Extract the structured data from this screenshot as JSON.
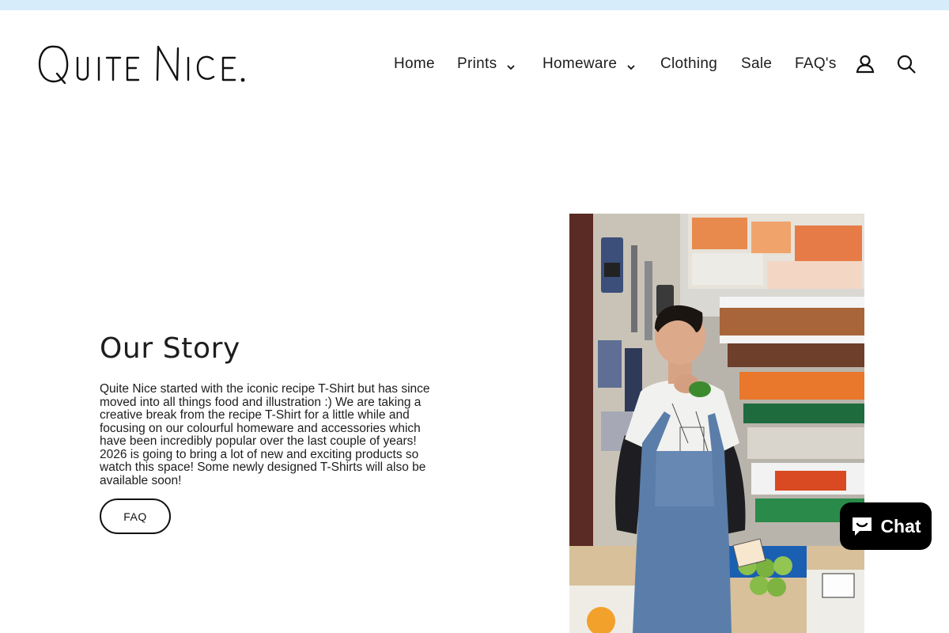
{
  "announcement": {
    "color": "#d6ecfb"
  },
  "header": {
    "logo_text": "QUITE NICE.",
    "nav": {
      "home": "Home",
      "prints": "Prints",
      "homeware": "Homeware",
      "clothing": "Clothing",
      "sale": "Sale",
      "faqs": "FAQ's"
    },
    "icons": {
      "account": "account-icon",
      "search": "search-icon",
      "dropdown": "chevron-down-icon"
    }
  },
  "story": {
    "title": "Our Story",
    "body": "Quite Nice started with the iconic recipe T-Shirt but has since moved into all things food and illustration :) We are taking a creative break from the recipe T-Shirt for a little while and focusing on our colourful homeware and accessories which have been incredibly popular over the last couple of years! 2026 is going to bring a lot of new and exciting products so watch this space! Some newly designed T-Shirts will also be available soon!",
    "button_label": "FAQ"
  },
  "chat": {
    "label": "Chat",
    "icon": "chat-bubble-icon"
  },
  "colors": {
    "text": "#1c1d1d",
    "chat_bg": "#000000",
    "announcement": "#d6ecfb"
  }
}
